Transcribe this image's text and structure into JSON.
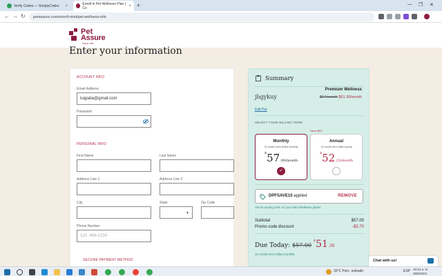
{
  "browser": {
    "tabs": [
      {
        "title": "Verify Codes — SimplyCodes"
      },
      {
        "title": "Enroll in Pet Wellness Plan | Co"
      }
    ],
    "new_tab": "+",
    "close_glyph": "×",
    "url": "petassure.com/enroll-mint/pet-wellness-info"
  },
  "header": {
    "logo_top": "Pet",
    "logo_bottom": "Assure",
    "logo_since": "SINCE 1995"
  },
  "page_title": "Enter your information",
  "form": {
    "account_title": "ACCOUNT INFO",
    "email_label": "Email Address",
    "email_value": "luigialia@gmail.com",
    "password_label": "Password",
    "personal_title": "PERSONAL INFO",
    "first_name_label": "First Name",
    "last_name_label": "Last Name",
    "address1_label": "Address Line 1",
    "address2_label": "Address Line 2",
    "city_label": "City",
    "state_label": "State",
    "zip_label": "Zip Code",
    "phone_label": "Phone Number",
    "phone_placeholder": "123 -456-1234",
    "payment_title": "SECURE PAYMENT METHOD"
  },
  "summary": {
    "title": "Summary",
    "pet_name": "jhgykuy",
    "plan_name": "Premium Wellness",
    "old_price": "$57/month",
    "new_price": "$51.30/month",
    "edit_pet": "Edit Pet",
    "billing_label": "SELECT YOUR BILLING TERM",
    "save_tag": "Save $57!",
    "monthly": {
      "title": "Monthly",
      "subtitle": "12 month term billed monthly",
      "dollar": "$",
      "amount": "57",
      "cents": ".00/month",
      "check": "✓"
    },
    "annual": {
      "title": "Annual",
      "subtitle": "12 month term billed yearly",
      "dollar": "$",
      "amount": "52",
      "cents": ".25/month"
    },
    "promo_code": "DPFSAVE10",
    "promo_applied": "applied",
    "remove": "REMOVE",
    "saving_note": "You're saving 10% on your Mint Wellness plans!",
    "subtotal_label": "Subtotal",
    "subtotal_value": "$57.00",
    "discount_label": "Promo code discount",
    "discount_value": "-$5.70",
    "due_label": "Due Today:",
    "due_old": "$57.00",
    "due_dollar": "$",
    "due_big": "51",
    "due_cents": ".30",
    "billed_note": "12 month term billed monthly"
  },
  "chat": {
    "label": "Chat with us!"
  },
  "taskbar": {
    "weather": "33°C  Parc. soleado",
    "lang": "ESP",
    "time": "10:24 a. m.",
    "date": "28/5/2024"
  }
}
